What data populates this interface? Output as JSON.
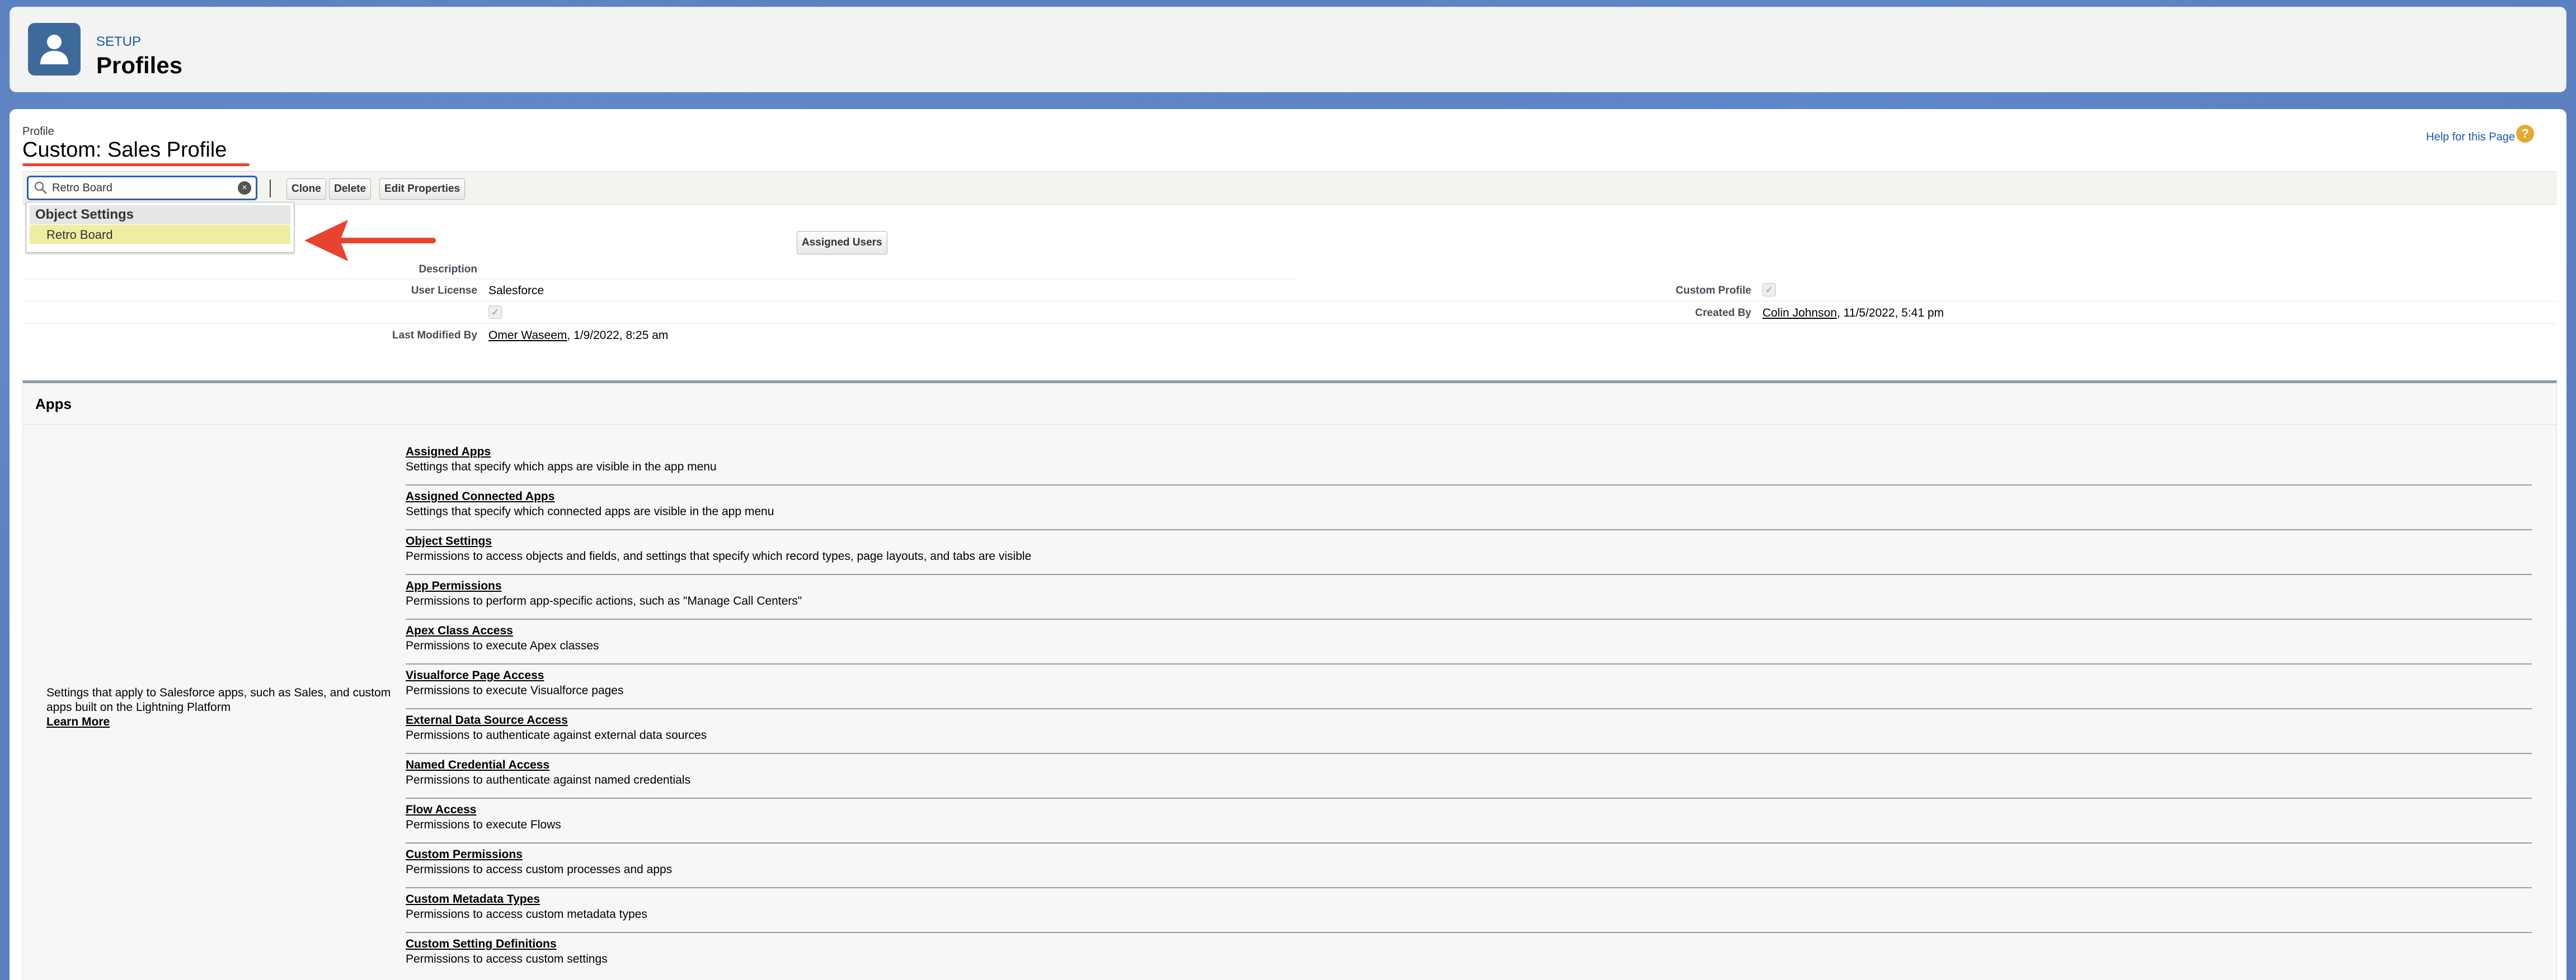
{
  "setup_header": {
    "eyebrow": "SETUP",
    "title": "Profiles",
    "icon": "user-icon"
  },
  "profile": {
    "eyebrow": "Profile",
    "title": "Custom: Sales Profile",
    "help_link": "Help for this Page",
    "help_icon": "?"
  },
  "toolbar": {
    "search_value": "Retro Board",
    "clone_label": "Clone",
    "delete_label": "Delete",
    "edit_properties_label": "Edit Properties"
  },
  "dropdown": {
    "header": "Object Settings",
    "items": [
      "Retro Board"
    ]
  },
  "assigned_users_label": "Assigned Users",
  "details": {
    "description_label": "Description",
    "user_license_label": "User License",
    "user_license_value": "Salesforce",
    "custom_profile_label": "Custom Profile",
    "created_by_label": "Created By",
    "created_by_user": "Colin Johnson",
    "created_by_date": ", 11/5/2022, 5:41 pm",
    "last_modified_label": "Last Modified By",
    "last_modified_user": "Omer Waseem",
    "last_modified_date": ", 1/9/2022, 8:25 am"
  },
  "apps": {
    "title": "Apps",
    "description": "Settings that apply to Salesforce apps, such as Sales, and custom apps built on the Lightning Platform",
    "learn_more": "Learn More",
    "items": [
      {
        "title": "Assigned Apps",
        "desc": "Settings that specify which apps are visible in the app menu"
      },
      {
        "title": "Assigned Connected Apps",
        "desc": "Settings that specify which connected apps are visible in the app menu"
      },
      {
        "title": "Object Settings",
        "desc": "Permissions to access objects and fields, and settings that specify which record types, page layouts, and tabs are visible"
      },
      {
        "title": "App Permissions",
        "desc": "Permissions to perform app-specific actions, such as \"Manage Call Centers\""
      },
      {
        "title": "Apex Class Access",
        "desc": "Permissions to execute Apex classes"
      },
      {
        "title": "Visualforce Page Access",
        "desc": "Permissions to execute Visualforce pages"
      },
      {
        "title": "External Data Source Access",
        "desc": "Permissions to authenticate against external data sources"
      },
      {
        "title": "Named Credential Access",
        "desc": "Permissions to authenticate against named credentials"
      },
      {
        "title": "Flow Access",
        "desc": "Permissions to execute Flows"
      },
      {
        "title": "Custom Permissions",
        "desc": "Permissions to access custom processes and apps"
      },
      {
        "title": "Custom Metadata Types",
        "desc": "Permissions to access custom metadata types"
      },
      {
        "title": "Custom Setting Definitions",
        "desc": "Permissions to access custom settings"
      }
    ]
  },
  "colors": {
    "brand_blue": "#3e6a9a",
    "link_blue": "#1a5ca8",
    "annotation_red": "#e8432f",
    "highlight_yellow": "#eeeea0"
  }
}
